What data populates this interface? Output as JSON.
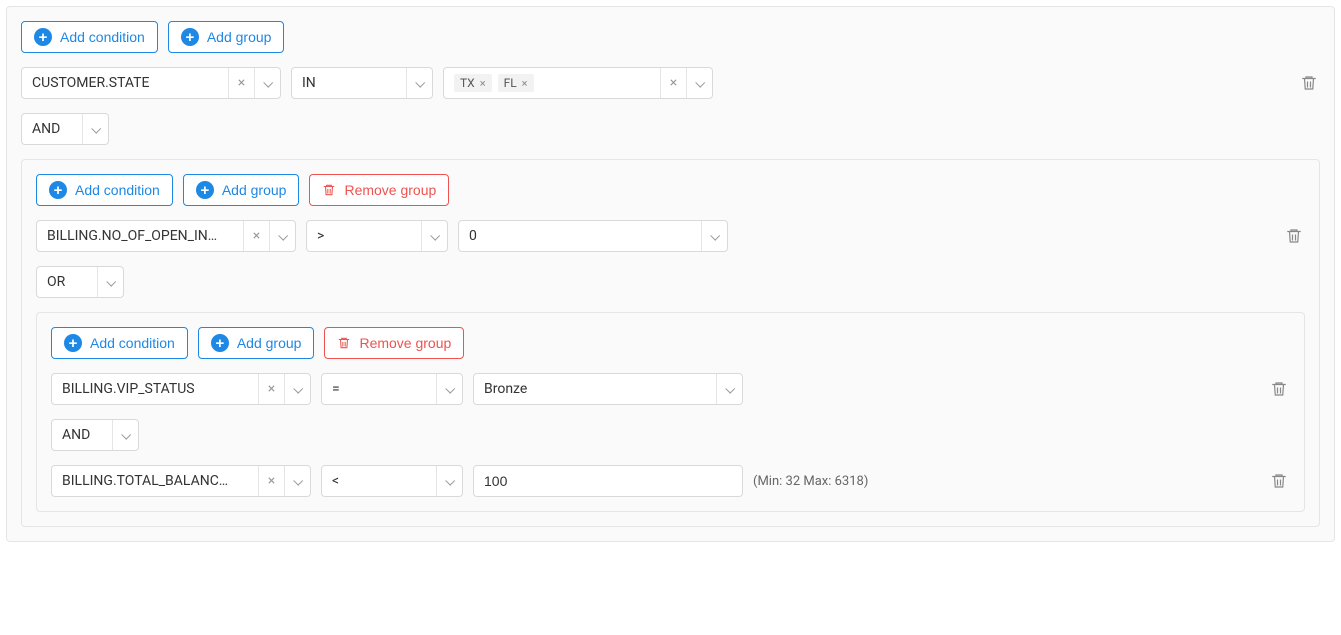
{
  "labels": {
    "add_condition": "Add condition",
    "add_group": "Add group",
    "remove_group": "Remove group"
  },
  "root": {
    "condition1": {
      "field": "CUSTOMER.STATE",
      "op": "IN",
      "tags": [
        "TX",
        "FL"
      ]
    },
    "logic1": "AND",
    "group2": {
      "condition2_1": {
        "field": "BILLING.NO_OF_OPEN_IN…",
        "op": ">",
        "value": "0"
      },
      "logic2": "OR",
      "group3": {
        "condition3_1": {
          "field": "BILLING.VIP_STATUS",
          "op": "=",
          "value": "Bronze"
        },
        "logic3": "AND",
        "condition3_2": {
          "field": "BILLING.TOTAL_BALANC…",
          "op": "<",
          "value": "100",
          "hint": "(Min: 32 Max: 6318)"
        }
      }
    }
  }
}
